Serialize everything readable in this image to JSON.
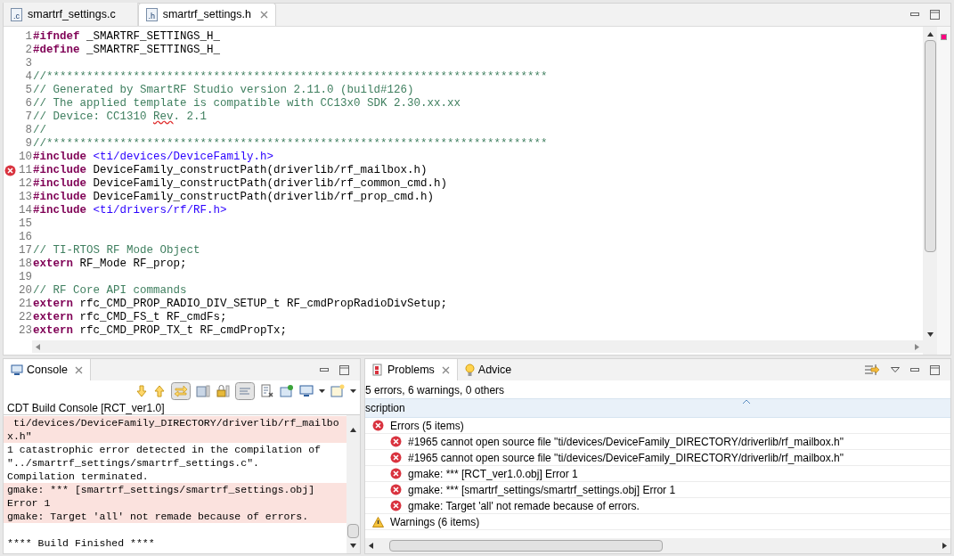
{
  "editor": {
    "tabs": [
      {
        "label": "smartrf_settings.c",
        "icon_text": ".c",
        "selected": false,
        "closable": false
      },
      {
        "label": "smartrf_settings.h",
        "icon_text": ".h",
        "selected": true,
        "closable": true
      }
    ],
    "lines": [
      {
        "number": "1",
        "error": false,
        "tokens": [
          {
            "kind": "keyword",
            "text": "#ifndef"
          },
          {
            "kind": "plain",
            "text": " _SMARTRF_SETTINGS_H_"
          }
        ]
      },
      {
        "number": "2",
        "error": false,
        "tokens": [
          {
            "kind": "keyword",
            "text": "#define"
          },
          {
            "kind": "plain",
            "text": " _SMARTRF_SETTINGS_H_"
          }
        ]
      },
      {
        "number": "3",
        "error": false
      },
      {
        "number": "4",
        "error": false,
        "tokens": [
          {
            "kind": "comment",
            "text": "//***************************************************************************"
          }
        ]
      },
      {
        "number": "5",
        "error": false,
        "tokens": [
          {
            "kind": "comment",
            "text": "// Generated by SmartRF Studio version 2.11.0 (build#126)"
          }
        ]
      },
      {
        "number": "6",
        "error": false,
        "tokens": [
          {
            "kind": "comment",
            "text": "// The applied template is compatible with CC13x0 SDK 2.30.xx.xx"
          }
        ]
      },
      {
        "number": "7",
        "error": false,
        "tokens": [
          {
            "kind": "comment",
            "text": "// Device: CC1310 "
          },
          {
            "kind": "misspelled",
            "text": "Rev"
          },
          {
            "kind": "comment",
            "text": ". 2.1"
          }
        ]
      },
      {
        "number": "8",
        "error": false,
        "tokens": [
          {
            "kind": "comment",
            "text": "//"
          }
        ]
      },
      {
        "number": "9",
        "error": false,
        "tokens": [
          {
            "kind": "comment",
            "text": "//***************************************************************************"
          }
        ]
      },
      {
        "number": "10",
        "error": false,
        "tokens": [
          {
            "kind": "keyword",
            "text": "#include"
          },
          {
            "kind": "string",
            "text": " <ti/devices/DeviceFamily.h>"
          }
        ]
      },
      {
        "number": "11",
        "error": true,
        "tokens": [
          {
            "kind": "keyword",
            "text": "#include"
          },
          {
            "kind": "plain",
            "text": " DeviceFamily_constructPath(driverlib/rf_mailbox.h)"
          }
        ]
      },
      {
        "number": "12",
        "error": false,
        "tokens": [
          {
            "kind": "keyword",
            "text": "#include"
          },
          {
            "kind": "plain",
            "text": " DeviceFamily_constructPath(driverlib/rf_common_cmd.h)"
          }
        ]
      },
      {
        "number": "13",
        "error": false,
        "tokens": [
          {
            "kind": "keyword",
            "text": "#include"
          },
          {
            "kind": "plain",
            "text": " DeviceFamily_constructPath(driverlib/rf_prop_cmd.h)"
          }
        ]
      },
      {
        "number": "14",
        "error": false,
        "tokens": [
          {
            "kind": "keyword",
            "text": "#include"
          },
          {
            "kind": "string",
            "text": " <ti/drivers/rf/RF.h>"
          }
        ]
      },
      {
        "number": "15",
        "error": false
      },
      {
        "number": "16",
        "error": false
      },
      {
        "number": "17",
        "error": false,
        "tokens": [
          {
            "kind": "comment",
            "text": "// TI-RTOS RF Mode Object"
          }
        ]
      },
      {
        "number": "18",
        "error": false,
        "tokens": [
          {
            "kind": "keyword",
            "text": "extern"
          },
          {
            "kind": "plain",
            "text": " RF_Mode RF_prop;"
          }
        ]
      },
      {
        "number": "19",
        "error": false
      },
      {
        "number": "20",
        "error": false,
        "tokens": [
          {
            "kind": "comment",
            "text": "// RF Core API commands"
          }
        ]
      },
      {
        "number": "21",
        "error": false,
        "tokens": [
          {
            "kind": "keyword",
            "text": "extern"
          },
          {
            "kind": "plain",
            "text": " rfc_CMD_PROP_RADIO_DIV_SETUP_t RF_cmdPropRadioDivSetup;"
          }
        ]
      },
      {
        "number": "22",
        "error": false,
        "tokens": [
          {
            "kind": "keyword",
            "text": "extern"
          },
          {
            "kind": "plain",
            "text": " rfc_CMD_FS_t RF_cmdFs;"
          }
        ]
      },
      {
        "number": "23",
        "error": false,
        "tokens": [
          {
            "kind": "keyword",
            "text": "extern"
          },
          {
            "kind": "plain",
            "text": " rfc_CMD_PROP_TX_t RF_cmdPropTx;"
          }
        ]
      }
    ]
  },
  "console": {
    "tab": "Console",
    "title": "CDT Build Console [RCT_ver1.0]",
    "lines": [
      {
        "text": " ti/devices/DeviceFamily_DIRECTORY/driverlib/rf_mailbo",
        "error": true
      },
      {
        "text": "x.h\"",
        "error": true
      },
      {
        "text": "1 catastrophic error detected in the compilation of",
        "error": false
      },
      {
        "text": "\"../smartrf_settings/smartrf_settings.c\".",
        "error": false
      },
      {
        "text": "Compilation terminated.",
        "error": false
      },
      {
        "text": "gmake: *** [smartrf_settings/smartrf_settings.obj]",
        "error": true
      },
      {
        "text": "Error 1",
        "error": true
      },
      {
        "text": "gmake: Target 'all' not remade because of errors.",
        "error": true
      }
    ],
    "footer": "**** Build Finished ****"
  },
  "problems": {
    "tabs": [
      {
        "label": "Problems",
        "selected": true
      },
      {
        "label": "Advice",
        "selected": false
      }
    ],
    "summary": "5 errors, 6 warnings, 0 others",
    "column": "scription",
    "groups": [
      {
        "kind": "error",
        "label": "Errors (5 items)",
        "children": [
          "#1965 cannot open source file \"ti/devices/DeviceFamily_DIRECTORY/driverlib/rf_mailbox.h\"",
          "#1965 cannot open source file \"ti/devices/DeviceFamily_DIRECTORY/driverlib/rf_mailbox.h\"",
          "gmake: *** [RCT_ver1.0.obj] Error 1",
          "gmake: *** [smartrf_settings/smartrf_settings.obj] Error 1",
          "gmake: Target 'all' not remade because of errors."
        ]
      },
      {
        "kind": "warning",
        "label": "Warnings (6 items)"
      }
    ]
  }
}
